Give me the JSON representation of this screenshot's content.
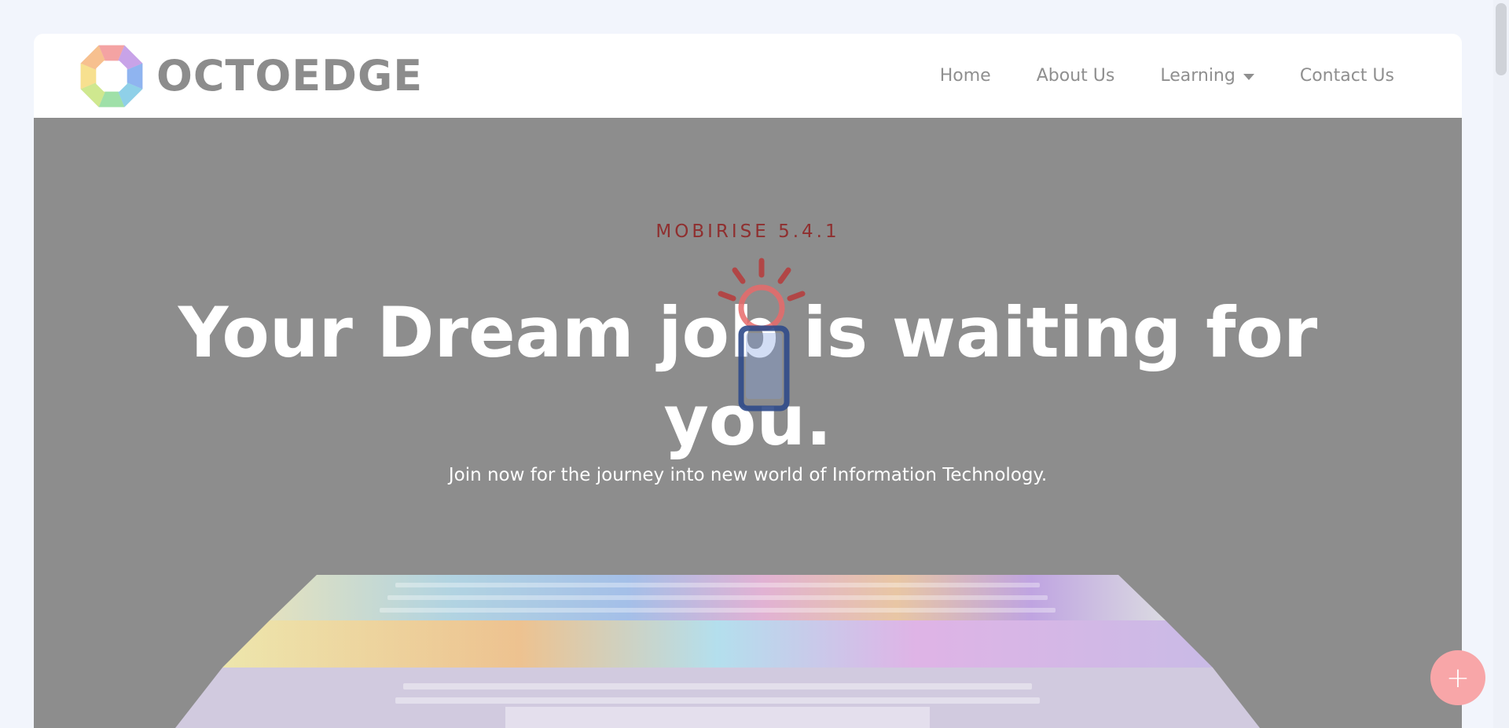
{
  "header": {
    "brand_name": "OCTOEDGE",
    "logo_icon": "octagon-ring-logo",
    "nav": [
      {
        "label": "Home",
        "has_dropdown": false
      },
      {
        "label": "About Us",
        "has_dropdown": false
      },
      {
        "label": "Learning",
        "has_dropdown": true
      },
      {
        "label": "Contact Us",
        "has_dropdown": false
      }
    ]
  },
  "hero": {
    "kicker": "MOBIRISE  5.4.1",
    "headline": "Your Dream job is waiting for you.",
    "subline": "Join now for the journey into new world of Information Technology.",
    "background_image": "laptop-keyboard-photo",
    "overlay_icon": "sun-and-phone-icon"
  },
  "fab": {
    "icon": "plus-icon",
    "label": "+"
  },
  "colors": {
    "page_bg": "#f2f5fc",
    "hero_overlay": "#8d8d8d",
    "kicker": "#8f2f2f",
    "fab": "#f8a6a8",
    "nav_text": "#8f8f8f"
  }
}
